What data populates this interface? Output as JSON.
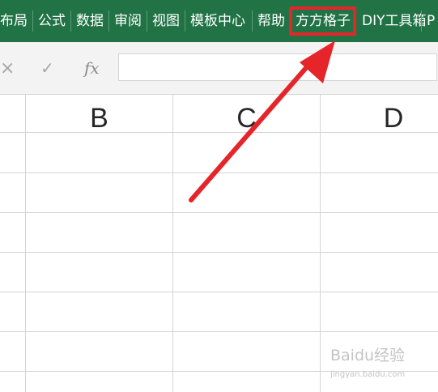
{
  "ribbon": {
    "tabs": [
      {
        "label": "布局"
      },
      {
        "label": "公式"
      },
      {
        "label": "数据"
      },
      {
        "label": "审阅"
      },
      {
        "label": "视图"
      },
      {
        "label": "模板中心"
      },
      {
        "label": "帮助"
      },
      {
        "label": "方方格子"
      },
      {
        "label": "DIY工具箱"
      },
      {
        "label": "P"
      }
    ],
    "highlighted_tab": "方方格子",
    "bg_color": "#217346",
    "highlight_color": "#e5252a"
  },
  "formula_bar": {
    "cancel_icon": "×",
    "enter_icon": "✓",
    "fx_label": "fx",
    "value": ""
  },
  "grid": {
    "columns": [
      "B",
      "C",
      "D"
    ]
  },
  "annotation": {
    "arrow_color": "#e5252a",
    "target": "方方格子"
  },
  "watermark": {
    "text": "Baidu经验",
    "subtext": "jingyan.baidu.com"
  }
}
